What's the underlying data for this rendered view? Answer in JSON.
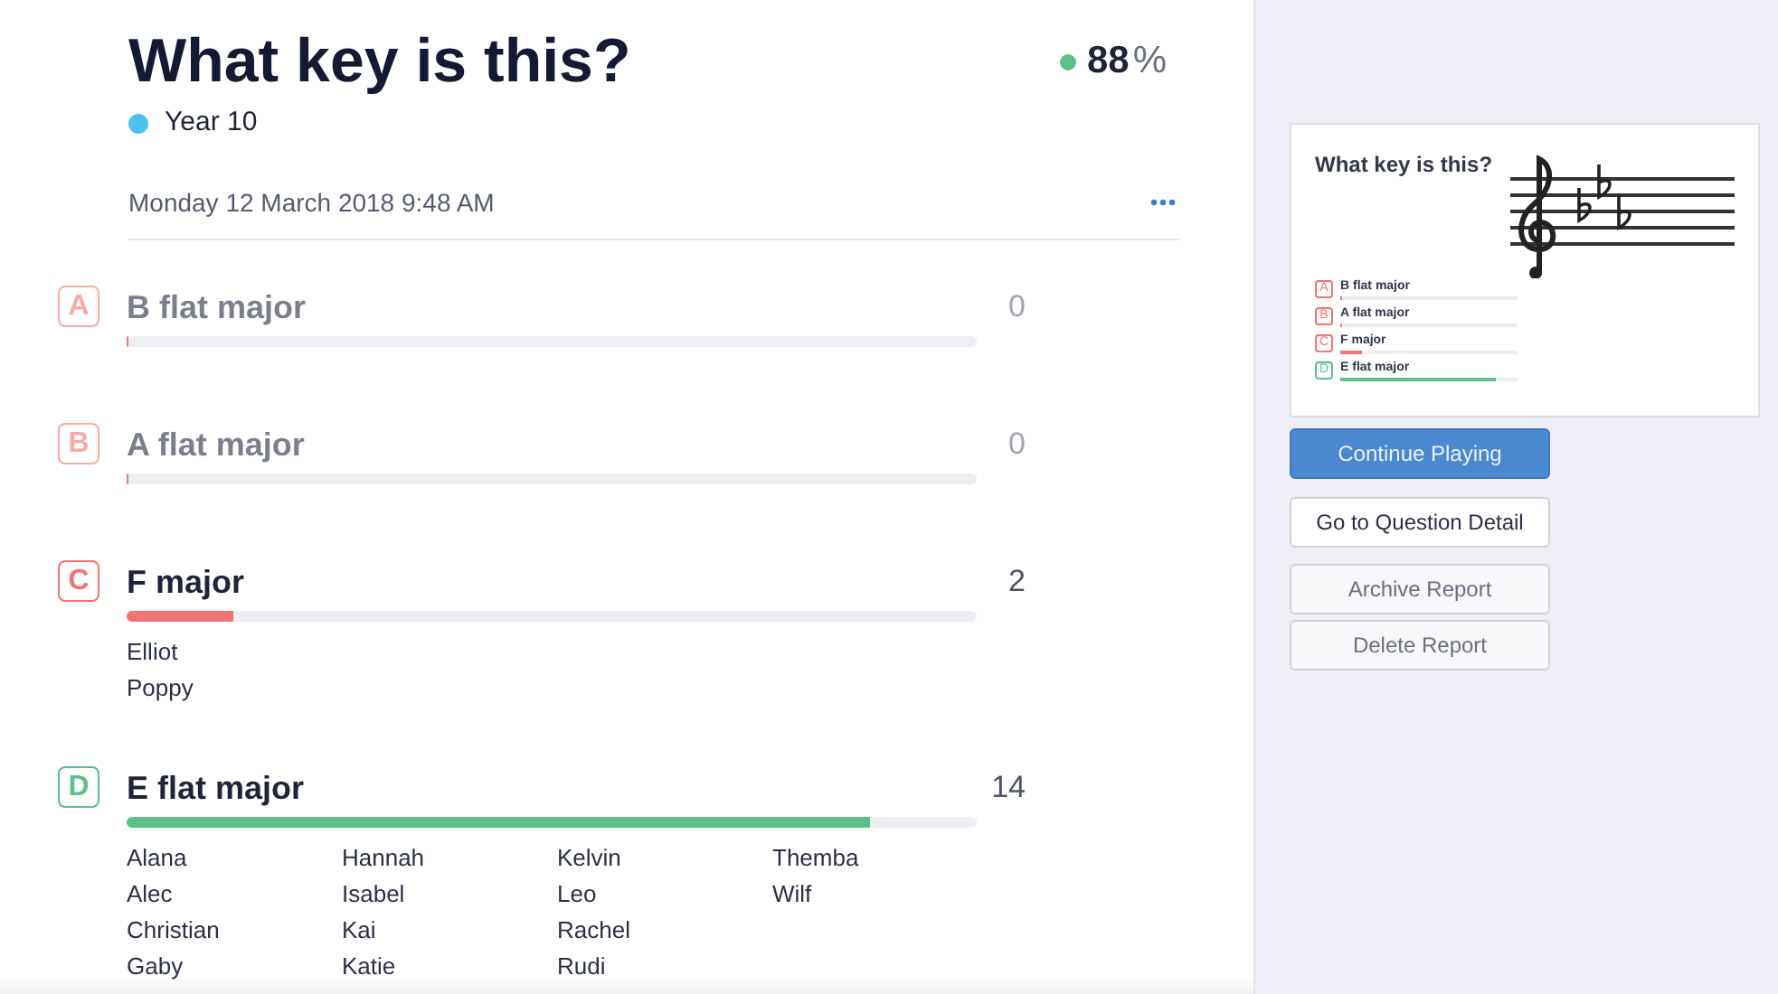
{
  "title": "What key is this?",
  "score": {
    "value": "88",
    "unit": "%",
    "color": "#5dbf8a"
  },
  "class": {
    "name": "Year 10",
    "color": "#4cc3ee"
  },
  "date": "Monday 12 March 2018 9:48 AM",
  "answers": [
    {
      "letter": "A",
      "label": "B flat major",
      "count": "0",
      "level": 0,
      "correct": false,
      "dimmed": true
    },
    {
      "letter": "B",
      "label": "A flat major",
      "count": "0",
      "level": 0,
      "correct": false,
      "dimmed": true
    },
    {
      "letter": "C",
      "label": "F major",
      "count": "2",
      "level": 0.125,
      "correct": false,
      "dimmed": false,
      "students": [
        "Elliot",
        "Poppy"
      ]
    },
    {
      "letter": "D",
      "label": "E flat major",
      "count": "14",
      "level": 0.875,
      "correct": true,
      "dimmed": false,
      "students": [
        "Alana",
        "Alec",
        "Christian",
        "Gaby",
        "Hannah",
        "Isabel",
        "Kai",
        "Katie",
        "Kelvin",
        "Leo",
        "Rachel",
        "Rudi",
        "Themba",
        "Wilf"
      ]
    }
  ],
  "preview": {
    "title": "What key is this?",
    "options": [
      {
        "letter": "A",
        "label": "B flat major",
        "level": 0,
        "correct": false
      },
      {
        "letter": "B",
        "label": "A flat major",
        "level": 0,
        "correct": false
      },
      {
        "letter": "C",
        "label": "F major",
        "level": 0.125,
        "correct": false
      },
      {
        "letter": "D",
        "label": "E flat major",
        "level": 0.875,
        "correct": true
      }
    ]
  },
  "buttons": [
    {
      "label": "Continue Playing",
      "kind": "primary"
    },
    {
      "label": "Go to Question Detail",
      "kind": "default"
    },
    {
      "label": "Archive Report",
      "kind": "muted"
    },
    {
      "label": "Delete Report",
      "kind": "muted"
    }
  ]
}
